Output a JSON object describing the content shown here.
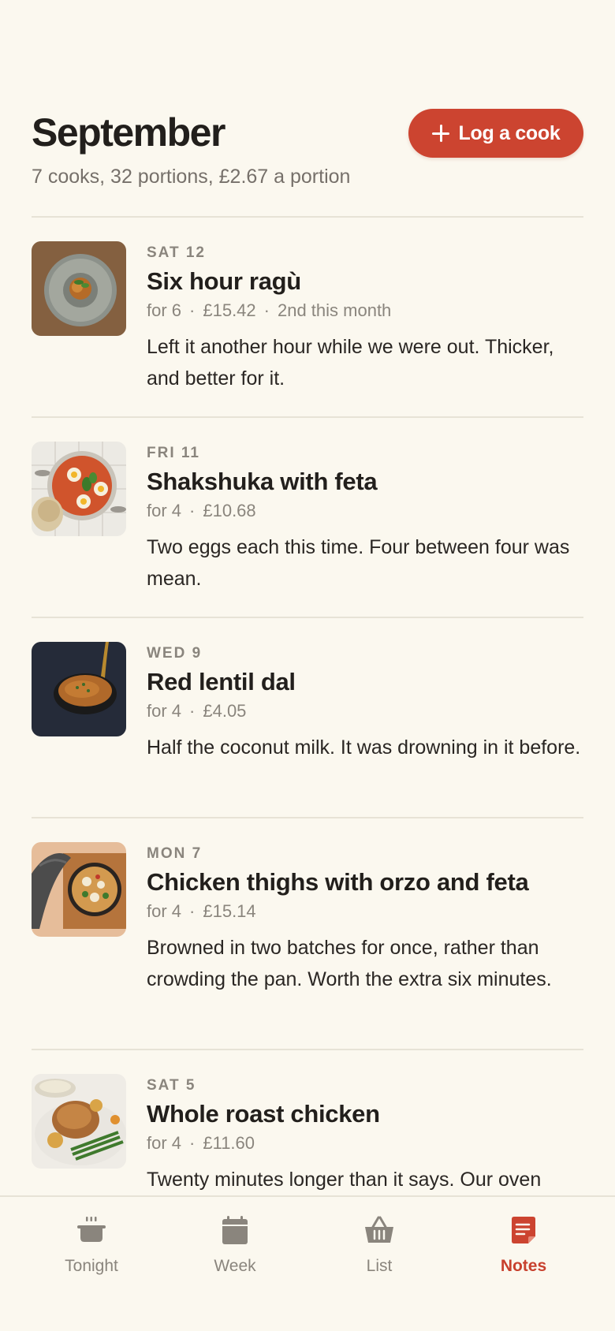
{
  "header": {
    "title": "September",
    "summary": "7 cooks, 32 portions, £2.67 a portion",
    "log_button": "Log a cook"
  },
  "entries": [
    {
      "day": "SAT 12",
      "title": "Six hour ragù",
      "portions": "for 6",
      "cost": "£15.42",
      "extra": "2nd this month",
      "note": "Left it another hour while we were out. Thicker, and better for it."
    },
    {
      "day": "FRI 11",
      "title": "Shakshuka with feta",
      "portions": "for 4",
      "cost": "£10.68",
      "note": "Two eggs each this time. Four between four was mean."
    },
    {
      "day": "WED 9",
      "title": "Red lentil dal",
      "portions": "for 4",
      "cost": "£4.05",
      "note": "Half the coconut milk. It was drowning in it before."
    },
    {
      "day": "MON 7",
      "title": "Chicken thighs with orzo and feta",
      "portions": "for 4",
      "cost": "£15.14",
      "note": "Browned in two batches for once, rather than crowding the pan. Worth the extra six minutes."
    },
    {
      "day": "SAT 5",
      "title": "Whole roast chicken",
      "portions": "for 4",
      "cost": "£11.60",
      "note": "Twenty minutes longer than it says. Our oven"
    }
  ],
  "tabs": [
    {
      "label": "Tonight",
      "icon": "pot-icon",
      "active": false
    },
    {
      "label": "Week",
      "icon": "calendar-icon",
      "active": false
    },
    {
      "label": "List",
      "icon": "basket-icon",
      "active": false
    },
    {
      "label": "Notes",
      "icon": "notes-icon",
      "active": true
    }
  ],
  "colors": {
    "background": "#fbf8ef",
    "accent": "#cc4430",
    "muted": "#8a857d",
    "text": "#221f1c"
  }
}
